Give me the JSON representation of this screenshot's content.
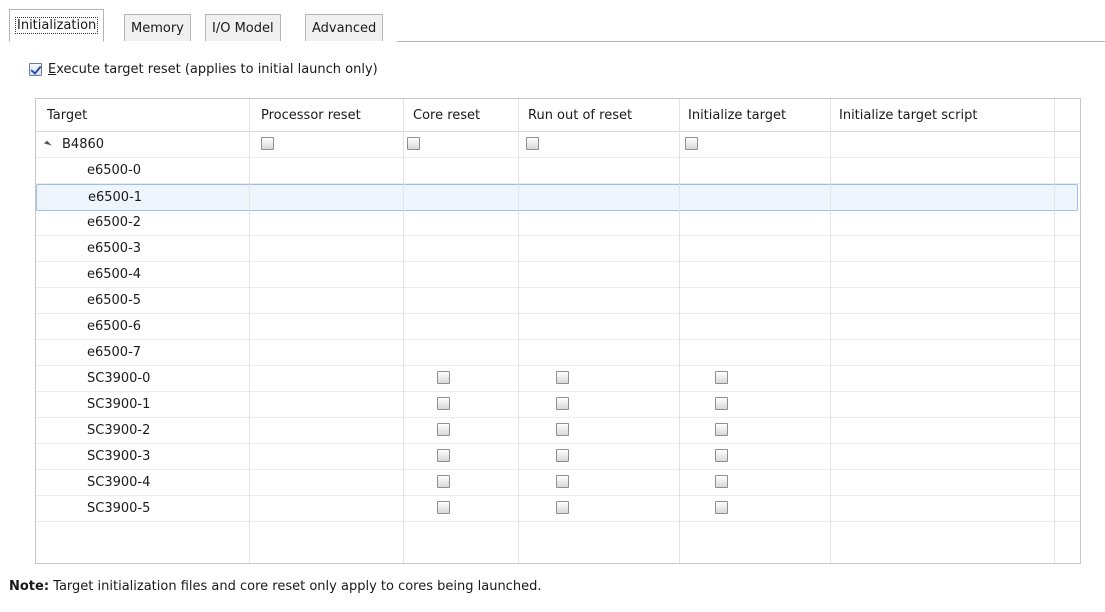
{
  "tabs": [
    {
      "label": "Initialization",
      "active": true
    },
    {
      "label": "Memory",
      "active": false
    },
    {
      "label": "I/O Model",
      "active": false
    },
    {
      "label": "Advanced",
      "active": false
    }
  ],
  "reset": {
    "checked": true,
    "label_accel": "E",
    "label_rest": "xecute target reset (applies to initial launch only)"
  },
  "columns": [
    "Target",
    "Processor reset",
    "Core reset",
    "Run out of reset",
    "Initialize target",
    "Initialize target script"
  ],
  "rows": [
    {
      "name": "B4860",
      "processor_reset": false,
      "core_reset": false,
      "run_out_of_reset": false,
      "initialize_target": false
    },
    {
      "name": "e6500-0"
    },
    {
      "name": "e6500-1",
      "selected": true
    },
    {
      "name": "e6500-2"
    },
    {
      "name": "e6500-3"
    },
    {
      "name": "e6500-4"
    },
    {
      "name": "e6500-5"
    },
    {
      "name": "e6500-6"
    },
    {
      "name": "e6500-7"
    },
    {
      "name": "SC3900-0",
      "core_reset": false,
      "run_out_of_reset": false,
      "initialize_target": false
    },
    {
      "name": "SC3900-1",
      "core_reset": false,
      "run_out_of_reset": false,
      "initialize_target": false
    },
    {
      "name": "SC3900-2",
      "core_reset": false,
      "run_out_of_reset": false,
      "initialize_target": false
    },
    {
      "name": "SC3900-3",
      "core_reset": false,
      "run_out_of_reset": false,
      "initialize_target": false
    },
    {
      "name": "SC3900-4",
      "core_reset": false,
      "run_out_of_reset": false,
      "initialize_target": false
    },
    {
      "name": "SC3900-5",
      "core_reset": false,
      "run_out_of_reset": false,
      "initialize_target": false
    }
  ],
  "note": {
    "label": "Note:",
    "text": " Target initialization files and core reset only apply to cores being launched."
  }
}
